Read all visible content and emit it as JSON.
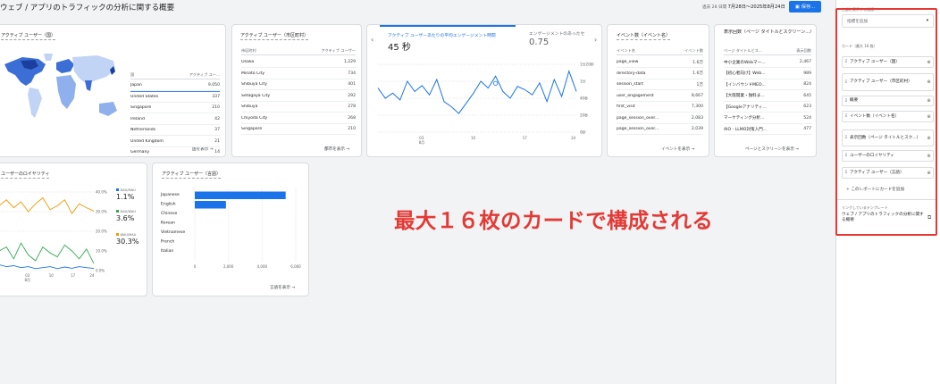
{
  "header": {
    "title": "ウェブ / アプリのトラフィックの分析に関する概要",
    "date_prefix": "過去 28 日間",
    "date_range": "7月28日～2025年8月24日",
    "save_label": "保存..."
  },
  "map_card": {
    "title": "アクティブ ユーザー（国）",
    "col1": "国",
    "col2": "アクティブ ユー...",
    "rows": [
      {
        "label": "Japan",
        "value": "9,050"
      },
      {
        "label": "United States",
        "value": "337"
      },
      {
        "label": "Singapore",
        "value": "210"
      },
      {
        "label": "Ireland",
        "value": "42"
      },
      {
        "label": "Netherlands",
        "value": "37"
      },
      {
        "label": "United Kingdom",
        "value": "21"
      },
      {
        "label": "Germany",
        "value": "14"
      }
    ],
    "footer": "国を表示"
  },
  "city_card": {
    "title": "アクティブ ユーザー（市区町村）",
    "col1": "市区町村",
    "col2": "アクティブ ユーザー",
    "rows": [
      {
        "label": "Osaka",
        "value": "1,229"
      },
      {
        "label": "Minato City",
        "value": "734"
      },
      {
        "label": "Shibuya City",
        "value": "401"
      },
      {
        "label": "Setagaya City",
        "value": "292"
      },
      {
        "label": "Shibuya",
        "value": "278"
      },
      {
        "label": "Chiyoda City",
        "value": "268"
      },
      {
        "label": "Singapore",
        "value": "210"
      }
    ],
    "footer": "都市を表示"
  },
  "engagement_card": {
    "metric1_label": "アクティブ ユーザーあたりの平均エンゲージメント時間",
    "metric1_value": "45 秒",
    "metric2_label": "エンゲージメントのあったセ",
    "metric2_value": "0.75",
    "chart_data": {
      "type": "line",
      "x_ticks": [
        "03\n8月",
        "10",
        "17",
        "24"
      ],
      "y_ticks": [
        "1分20秒",
        "1分",
        "40秒",
        "20秒",
        "0秒"
      ],
      "ylim": [
        0,
        80
      ],
      "values": [
        52,
        40,
        46,
        38,
        60,
        48,
        55,
        44,
        62,
        36,
        30,
        22,
        34,
        46,
        60,
        52,
        66,
        48,
        40,
        54,
        50,
        44,
        58,
        36,
        62,
        42,
        72,
        48
      ]
    }
  },
  "event_card": {
    "title": "イベント数（イベント名）",
    "col1": "イベント名",
    "col2": "イベント数",
    "rows": [
      {
        "label": "page_view",
        "value": "1.6万"
      },
      {
        "label": "directory-data",
        "value": "1.6万"
      },
      {
        "label": "session_start",
        "value": "1万"
      },
      {
        "label": "user_engagement",
        "value": "8,667"
      },
      {
        "label": "first_visit",
        "value": "7,300"
      },
      {
        "label": "page_session_over...",
        "value": "2,083"
      },
      {
        "label": "page_session_over...",
        "value": "2,039"
      }
    ],
    "footer": "イベントを表示"
  },
  "views_card": {
    "title": "表示回数（ページ タイトルとスクリーン...）",
    "title_line2": "ページ タイトルとスクリーン...",
    "col1": "ページ タイトルとス...",
    "col2": "表示回数",
    "rows": [
      {
        "label": "中小企業のWebマー...",
        "value": "2,467"
      },
      {
        "label": "【初心者向け】Web...",
        "value": "989"
      },
      {
        "label": "【インバウンドMEO...",
        "value": "824"
      },
      {
        "label": "【大阪開業・独料ま...",
        "value": "645"
      },
      {
        "label": "【Googleアナリティ...",
        "value": "623"
      },
      {
        "label": "マーケティング分析...",
        "value": "524"
      },
      {
        "label": "AIO - LLMO対策入門...",
        "value": "477"
      }
    ],
    "footer": "ページとスクリーンを表示"
  },
  "loyalty_card": {
    "title": "ユーザーのロイヤリティ",
    "legend": [
      {
        "name": "DAU/MAU",
        "value": "1.1%",
        "color": "#1a73e8"
      },
      {
        "name": "DAU/WAU",
        "value": "3.6%",
        "color": "#34a853"
      },
      {
        "name": "WAU/MAU",
        "value": "30.3%",
        "color": "#f29900"
      }
    ],
    "y_ticks": [
      "40.0%",
      "30.0%",
      "20.0%",
      "10.0%",
      "0.0%"
    ],
    "x_ticks": [
      "03\n8月",
      "10",
      "17",
      "24"
    ],
    "chart_data": {
      "type": "line",
      "ylim": [
        0,
        40
      ],
      "series": [
        {
          "name": "DAU/MAU",
          "values": [
            3,
            2,
            2.5,
            1.5,
            2,
            1,
            1.5,
            2,
            1,
            1.8,
            1.2,
            2,
            1.5,
            1.1
          ]
        },
        {
          "name": "DAU/WAU",
          "values": [
            10,
            12,
            6,
            14,
            8,
            5,
            12,
            9,
            7,
            13,
            10,
            6,
            11,
            3.6
          ]
        },
        {
          "name": "WAU/MAU",
          "values": [
            33,
            36,
            32,
            35,
            30,
            34,
            37,
            31,
            33,
            36,
            29,
            34,
            32,
            30.3
          ]
        }
      ]
    }
  },
  "language_card": {
    "title": "アクティブ ユーザー（言語）",
    "chart_data": {
      "type": "bar",
      "categories": [
        "Japanese",
        "English",
        "Chinese",
        "Korean",
        "Vietnamese",
        "French",
        "Italian"
      ],
      "values": [
        5400,
        1850,
        0,
        0,
        0,
        0,
        0
      ],
      "x_ticks": [
        "0",
        "2,000",
        "4,000",
        "6,000"
      ],
      "xlim": [
        0,
        6000
      ]
    },
    "footer": "言語を表示"
  },
  "annotation": "最大１６枚のカードで構成される",
  "sidebar": {
    "top_label": "上部に表示する指標",
    "metric_placeholder": "指標を追加",
    "cards_label": "カード（最大 16 枚）",
    "cards": [
      {
        "label": "アクティブ ユーザー（国）"
      },
      {
        "label": "アクティブ ユーザー（市区町村）"
      },
      {
        "label": "概要"
      },
      {
        "label": "イベント数（イベント名）"
      },
      {
        "label": "表示回数（ページ タイトルとスク...）"
      },
      {
        "label": "ユーザーのロイヤリティ"
      },
      {
        "label": "アクティブ ユーザー（言語）"
      }
    ],
    "add_card_label": "このレポートにカードを追加",
    "linked_label": "リンクしているテンプレート",
    "linked_template": "ウェブ / アプリのトラフィックの分析に関する概要"
  }
}
